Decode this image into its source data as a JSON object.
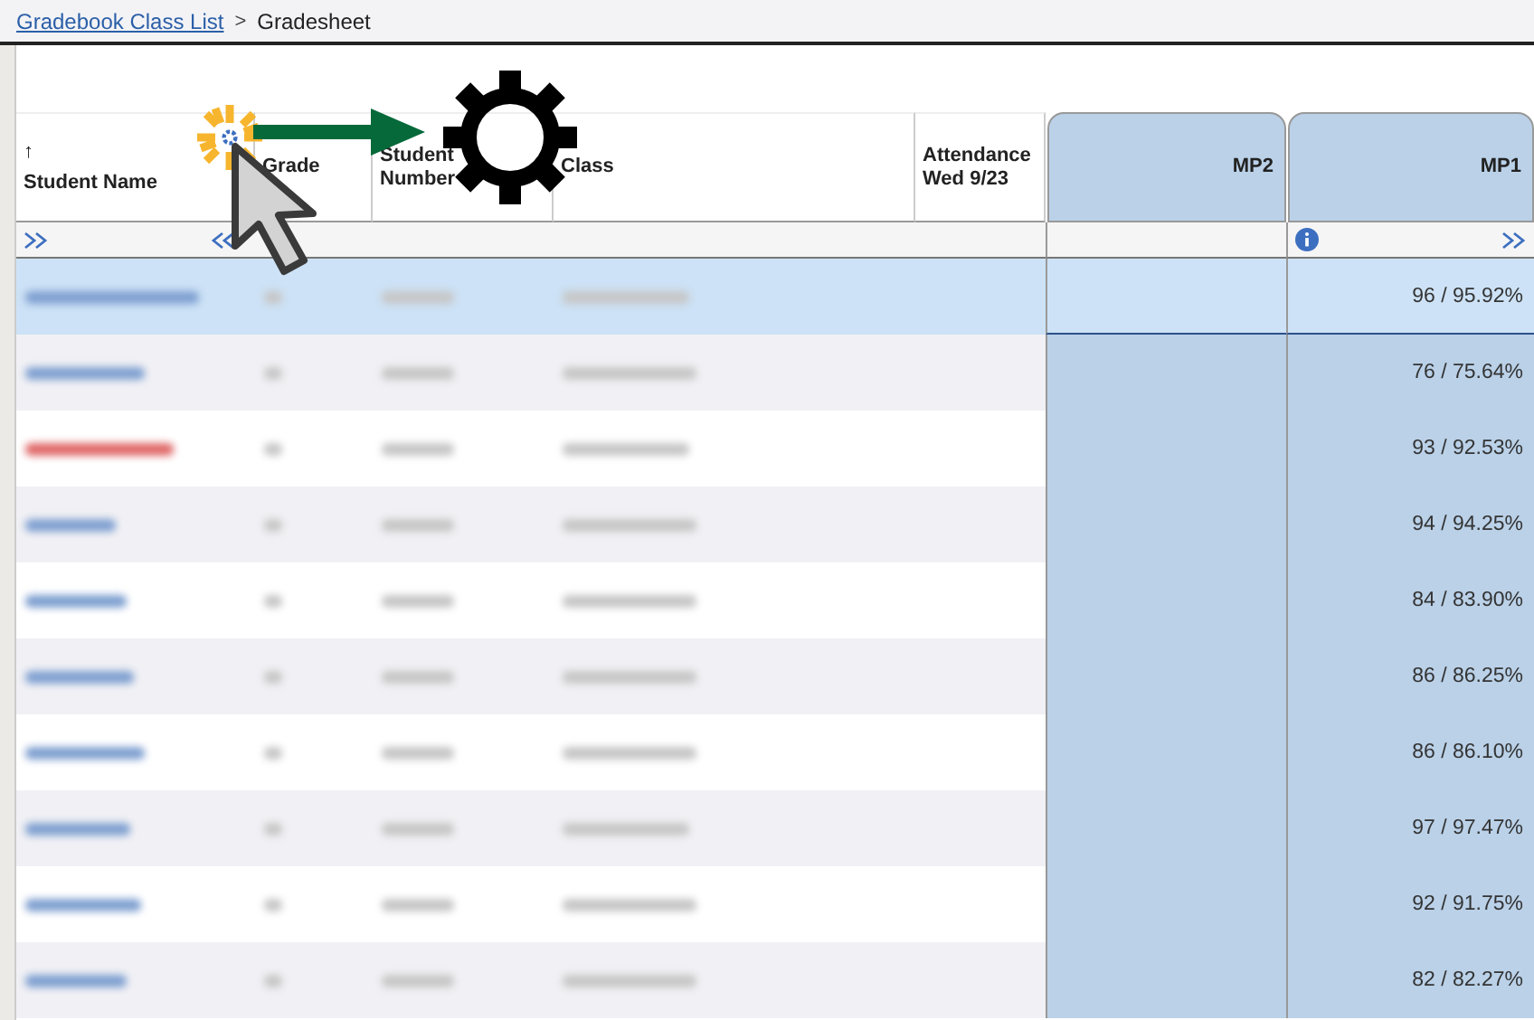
{
  "breadcrumb": {
    "link": "Gradebook Class List",
    "separator": ">",
    "current": "Gradesheet"
  },
  "columns": {
    "sort_indicator": "↑",
    "student_name": "Student Name",
    "grade": "Grade",
    "student_number": "Student Number",
    "class": "Class",
    "attendance": "Attendance Wed 9/23",
    "mp2": "MP2",
    "mp1": "MP1"
  },
  "rows": [
    {
      "selected": true,
      "flagged": false,
      "mp1": "96 / 95.92%"
    },
    {
      "selected": false,
      "flagged": false,
      "mp1": "76 / 75.64%"
    },
    {
      "selected": false,
      "flagged": true,
      "mp1": "93 / 92.53%"
    },
    {
      "selected": false,
      "flagged": false,
      "mp1": "94 / 94.25%"
    },
    {
      "selected": false,
      "flagged": false,
      "mp1": "84 / 83.90%"
    },
    {
      "selected": false,
      "flagged": false,
      "mp1": "86 / 86.25%"
    },
    {
      "selected": false,
      "flagged": false,
      "mp1": "86 / 86.10%"
    },
    {
      "selected": false,
      "flagged": false,
      "mp1": "97 / 97.47%"
    },
    {
      "selected": false,
      "flagged": false,
      "mp1": "92 / 91.75%"
    },
    {
      "selected": false,
      "flagged": false,
      "mp1": "82 / 82.27%"
    }
  ]
}
